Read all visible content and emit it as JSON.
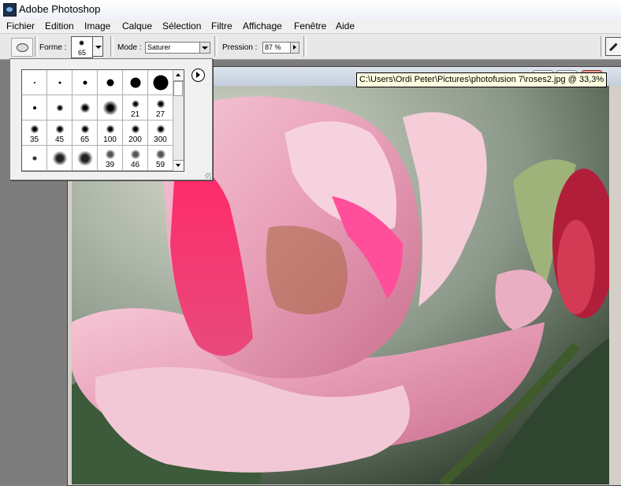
{
  "titlebar": {
    "title": "Adobe Photoshop",
    "icon": "photoshop-eye-icon"
  },
  "menu": [
    "Fichier",
    "Edition",
    "Image",
    "Calque",
    "Sélection",
    "Filtre",
    "Affichage",
    "Fenêtre",
    "Aide"
  ],
  "options": {
    "forme_label": "Forme :",
    "forme_size": "65",
    "mode_label": "Mode :",
    "mode_value": "Saturer",
    "pression_label": "Pression :",
    "pression_value": "87 %"
  },
  "document": {
    "tooltip": "C:\\Users\\Ordi Peter\\Pictures\\photofusion 7\\roses2.jpg @ 33,3%"
  },
  "brush_picker": {
    "row3_labels": [
      "35",
      "45",
      "65",
      "100",
      "200",
      "300"
    ],
    "row2_labels": [
      "",
      "",
      "",
      "",
      "21",
      "27"
    ],
    "row4_labels": [
      "",
      "",
      "",
      "39",
      "46",
      "59"
    ]
  },
  "colors": {
    "accent_close": "#c8483a",
    "tooltip_bg": "#ffffe1"
  }
}
